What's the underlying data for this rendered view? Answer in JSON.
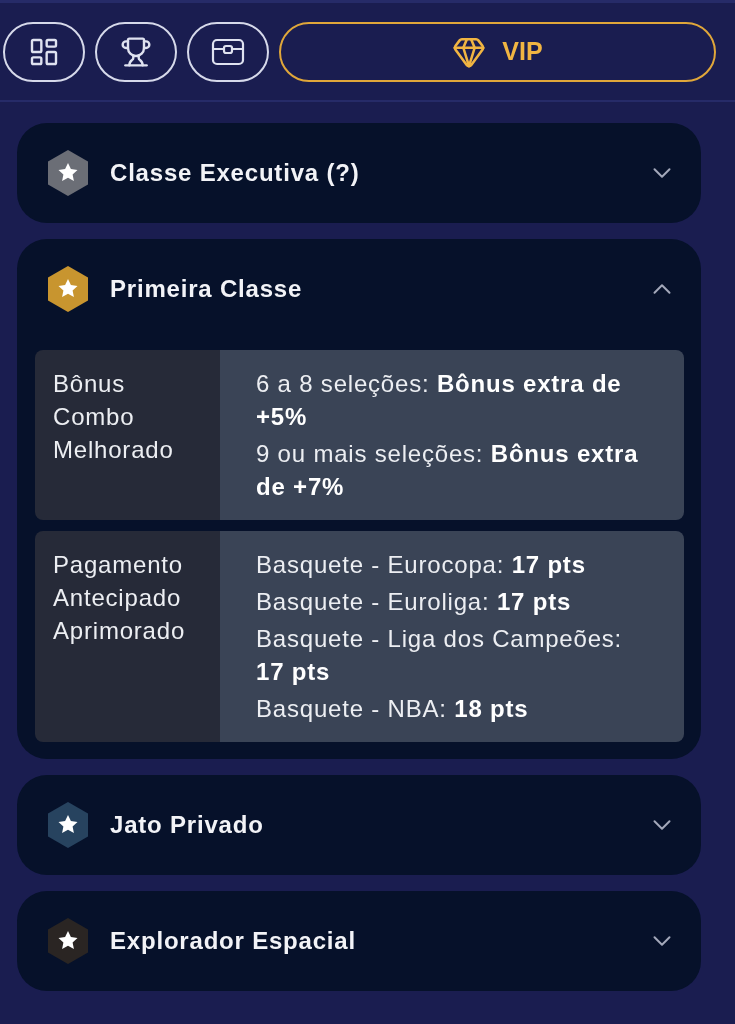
{
  "toolbar": {
    "vip_button": {
      "label": "VIP"
    }
  },
  "tiers": [
    {
      "name": "Classe Executiva (?)",
      "color": "#6b6e76",
      "expanded": false
    },
    {
      "name": "Primeira Classe",
      "color": "#c8952f",
      "expanded": true,
      "benefits": [
        {
          "label": "Bônus Combo Melhorado",
          "lines": [
            "6 a 8 seleções: **Bônus extra de +5%**",
            "9 ou mais seleções: **Bônus extra de +7%**"
          ]
        },
        {
          "label": "Pagamento Antecipado Aprimorado",
          "lines": [
            "Basquete - Eurocopa: **17 pts**",
            "Basquete - Euroliga: **17 pts**",
            "Basquete - Liga dos Campeões: **17 pts**",
            "Basquete - NBA: **18 pts**"
          ]
        }
      ]
    },
    {
      "name": "Jato Privado",
      "color": "#27435f",
      "expanded": false
    },
    {
      "name": "Explorador Espacial",
      "color": "#2a2523",
      "expanded": false
    }
  ]
}
